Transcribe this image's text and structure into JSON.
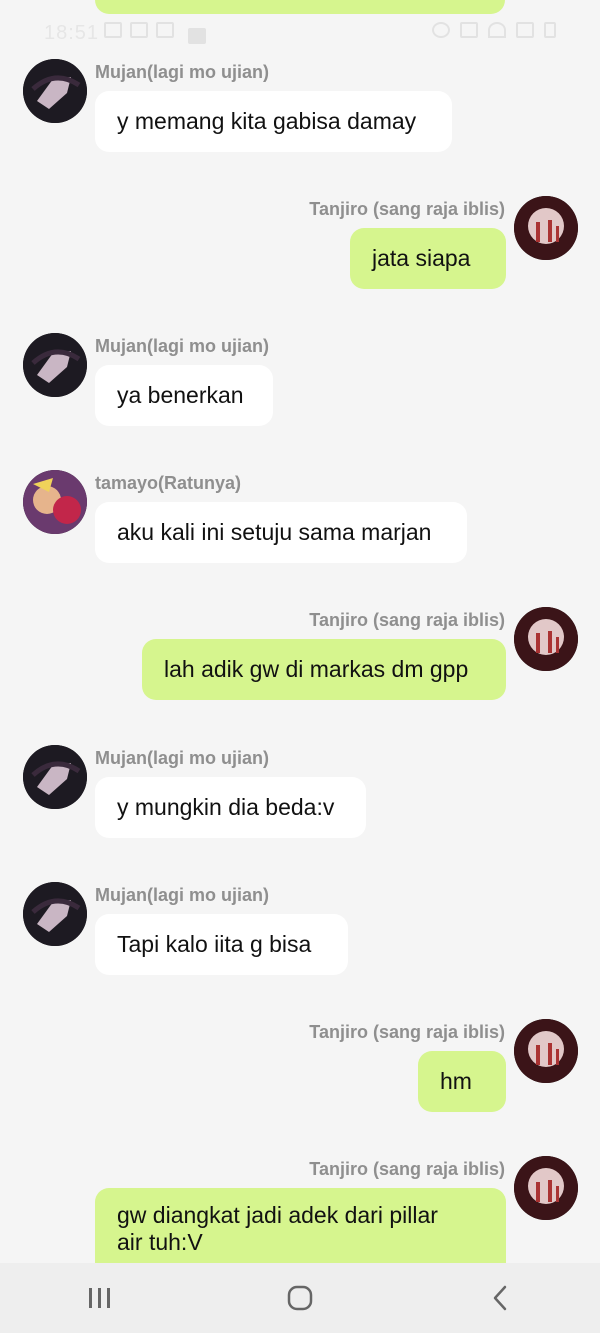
{
  "status_bar": {
    "time": "18:51"
  },
  "messages": [
    {
      "id": "m1",
      "side": "left",
      "sender": "Mujan(lagi mo ujian)",
      "text": "y memang kita gabisa damay",
      "avatar": "mujan-avatar"
    },
    {
      "id": "m2",
      "side": "right",
      "sender": "Tanjiro (sang raja iblis)",
      "text": "jata siapa",
      "avatar": "tanjiro-avatar"
    },
    {
      "id": "m3",
      "side": "left",
      "sender": "Mujan(lagi mo ujian)",
      "text": "ya benerkan",
      "avatar": "mujan-avatar"
    },
    {
      "id": "m4",
      "side": "left",
      "sender": "tamayo(Ratunya)",
      "text": "aku kali ini setuju sama marjan",
      "avatar": "tamayo-avatar"
    },
    {
      "id": "m5",
      "side": "right",
      "sender": "Tanjiro (sang raja iblis)",
      "text": "lah adik gw di markas dm gpp",
      "avatar": "tanjiro-avatar"
    },
    {
      "id": "m6",
      "side": "left",
      "sender": "Mujan(lagi mo ujian)",
      "text": "y mungkin dia beda:v",
      "avatar": "mujan-avatar"
    },
    {
      "id": "m7",
      "side": "left",
      "sender": "Mujan(lagi mo ujian)",
      "text": "Tapi kalo iita g bisa",
      "avatar": "mujan-avatar"
    },
    {
      "id": "m8",
      "side": "right",
      "sender": "Tanjiro (sang raja iblis)",
      "text": "hm",
      "avatar": "tanjiro-avatar"
    },
    {
      "id": "m9",
      "side": "right",
      "sender": "Tanjiro (sang raja iblis)",
      "text_line1": "gw diangkat jadi adek dari pillar",
      "text_line2": "air tuh:V",
      "avatar": "tanjiro-avatar"
    }
  ],
  "navbar": {
    "recent": "recent-apps-icon",
    "home": "home-icon",
    "back": "back-icon"
  },
  "colors": {
    "background": "#f5f5f5",
    "bubble_left": "#ffffff",
    "bubble_right": "#d6f58e",
    "sender": "#8f8f8f"
  }
}
